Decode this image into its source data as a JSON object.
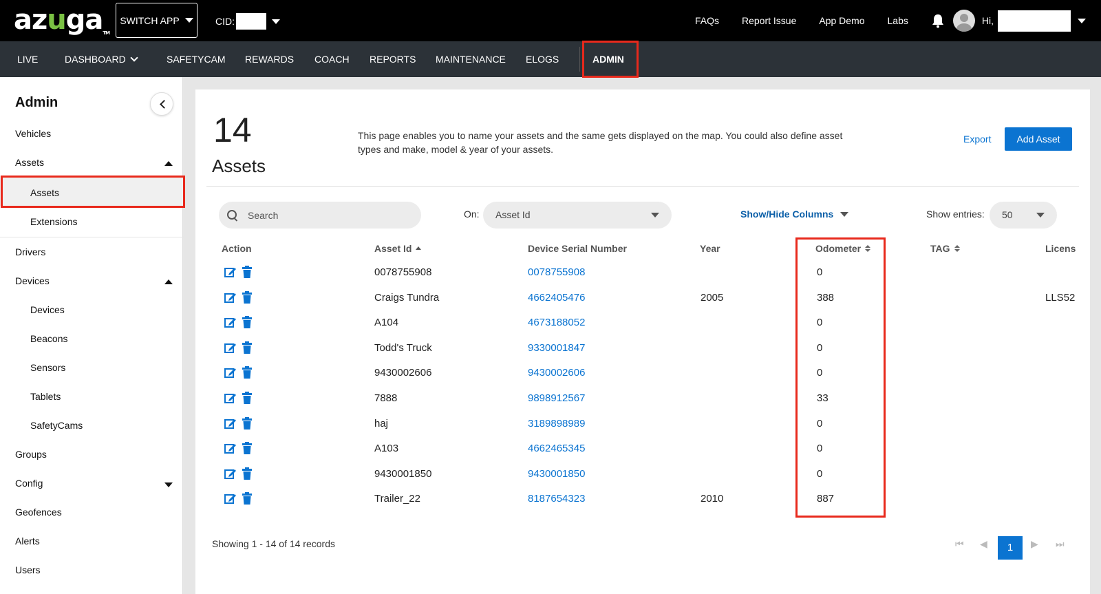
{
  "topbar": {
    "logo": {
      "pre": "az",
      "mid": "u",
      "post": "ga",
      "tm": "TM"
    },
    "switch_app": "SWITCH APP",
    "cid_label": "CID:",
    "links": [
      "FAQs",
      "Report Issue",
      "App Demo",
      "Labs"
    ],
    "greeting": "Hi,"
  },
  "nav": {
    "items": [
      "LIVE",
      "DASHBOARD",
      "SAFETYCAM",
      "REWARDS",
      "COACH",
      "REPORTS",
      "MAINTENANCE",
      "ELOGS",
      "ADMIN"
    ],
    "active": "ADMIN"
  },
  "sidebar": {
    "title": "Admin",
    "items": [
      "Vehicles",
      "Assets",
      "Assets",
      "Extensions",
      "Drivers",
      "Devices",
      "Devices",
      "Beacons",
      "Sensors",
      "Tablets",
      "SafetyCams",
      "Groups",
      "Config",
      "Geofences",
      "Alerts",
      "Users"
    ]
  },
  "main": {
    "count": "14",
    "count_label": "Assets",
    "description": "This page enables you to name your assets and the same gets displayed on the map. You could also define asset types and make, model & year of your assets.",
    "export_label": "Export",
    "add_label": "Add Asset",
    "search_placeholder": "Search",
    "on_label": "On:",
    "on_value": "Asset Id",
    "show_hide_label": "Show/Hide Columns",
    "entries_label": "Show entries:",
    "entries_value": "50",
    "columns": [
      "Action",
      "Asset Id",
      "Device Serial Number",
      "Year",
      "Odometer",
      "TAG",
      "Licens"
    ],
    "rows": [
      {
        "asset_id": "0078755908",
        "serial": "0078755908",
        "year": "",
        "odometer": "0",
        "license": ""
      },
      {
        "asset_id": "Craigs Tundra",
        "serial": "4662405476",
        "year": "2005",
        "odometer": "388",
        "license": "LLS52"
      },
      {
        "asset_id": "A104",
        "serial": "4673188052",
        "year": "",
        "odometer": "0",
        "license": ""
      },
      {
        "asset_id": "Todd's Truck",
        "serial": "9330001847",
        "year": "",
        "odometer": "0",
        "license": ""
      },
      {
        "asset_id": "9430002606",
        "serial": "9430002606",
        "year": "",
        "odometer": "0",
        "license": ""
      },
      {
        "asset_id": "7888",
        "serial": "9898912567",
        "year": "",
        "odometer": "33",
        "license": ""
      },
      {
        "asset_id": "haj",
        "serial": "3189898989",
        "year": "",
        "odometer": "0",
        "license": ""
      },
      {
        "asset_id": "A103",
        "serial": "4662465345",
        "year": "",
        "odometer": "0",
        "license": ""
      },
      {
        "asset_id": "9430001850",
        "serial": "9430001850",
        "year": "",
        "odometer": "0",
        "license": ""
      },
      {
        "asset_id": "Trailer_22",
        "serial": "8187654323",
        "year": "2010",
        "odometer": "887",
        "license": ""
      }
    ],
    "showing": "Showing 1 - 14 of 14 records",
    "current_page": "1"
  },
  "colors": {
    "accent": "#0b74d1",
    "highlight": "#e8291c",
    "nav_bg": "#2c3238",
    "logo_green": "#7ac143"
  }
}
